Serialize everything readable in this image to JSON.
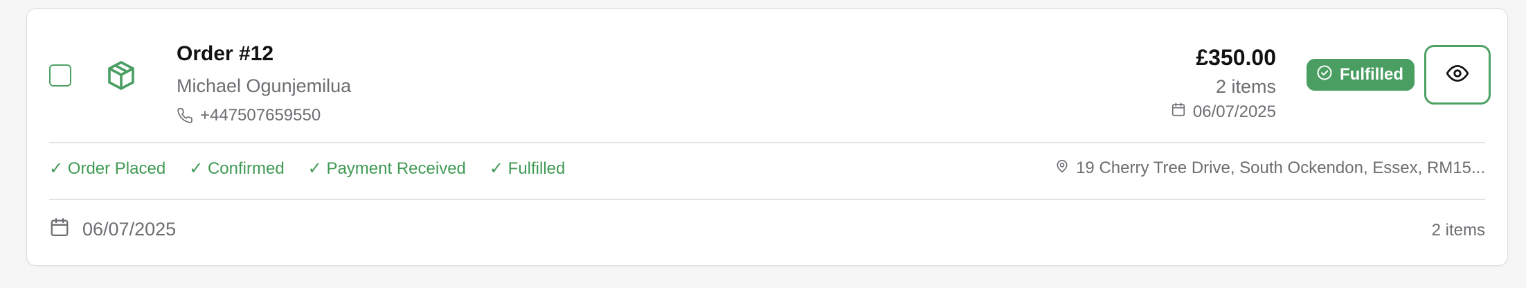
{
  "order": {
    "title": "Order #12",
    "customer": "Michael Ogunjemilua",
    "phone": "+447507659550",
    "price": "£350.00",
    "items": "2 items",
    "date": "06/07/2025",
    "status": "Fulfilled",
    "address": "19 Cherry Tree Drive, South Ockendon, Essex, RM15..."
  },
  "progress_steps": [
    {
      "label": "✓ Order Placed"
    },
    {
      "label": "✓ Confirmed"
    },
    {
      "label": "✓ Payment Received"
    },
    {
      "label": "✓ Fulfilled"
    }
  ],
  "footer": {
    "date": "06/07/2025",
    "items": "2 items"
  },
  "icons": {
    "package": "package-icon",
    "phone": "phone-icon",
    "calendar": "calendar-icon",
    "status": "check-circle-icon",
    "view": "eye-icon",
    "location": "map-pin-icon"
  },
  "colors": {
    "accent": "#4a9e62",
    "step_text": "#3f9a54",
    "muted_text": "#6d6d72"
  }
}
